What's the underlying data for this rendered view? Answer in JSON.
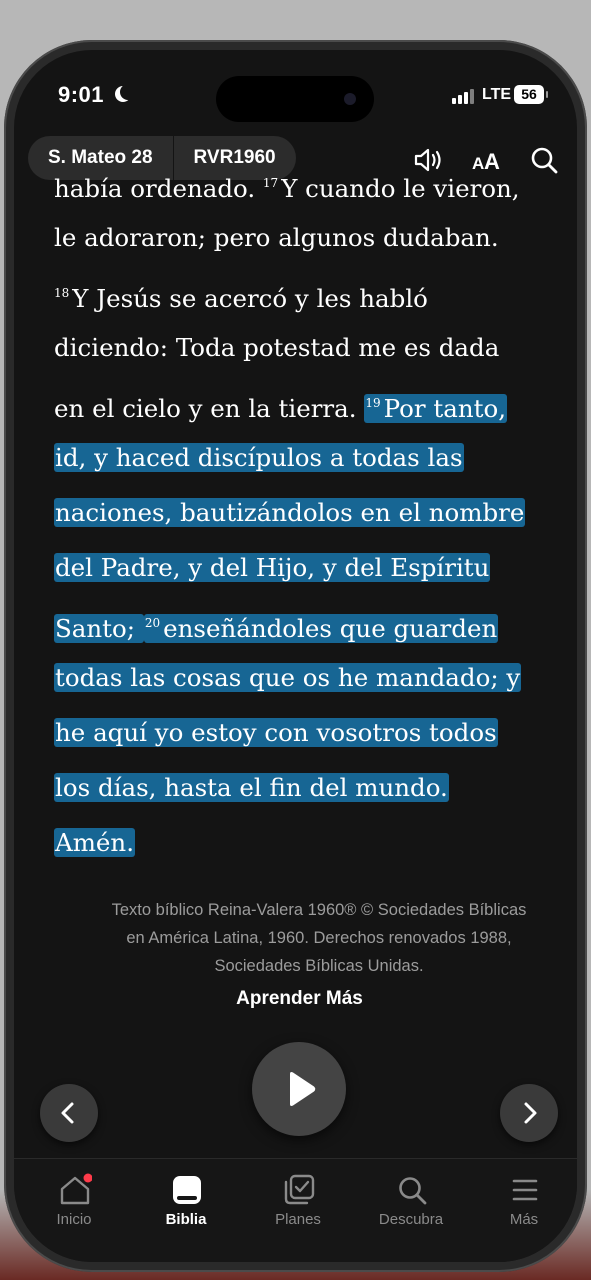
{
  "status_bar": {
    "time": "9:01",
    "network": "LTE",
    "battery": "56"
  },
  "toolbar": {
    "book_chapter": "S. Mateo 28",
    "version": "RVR1960"
  },
  "reader": {
    "lines": [
      {
        "segments": [
          {
            "text": "había ordenado. ",
            "hl": false
          },
          {
            "sup": "17",
            "text": "Y cuando le vieron,",
            "hl": false
          }
        ]
      },
      {
        "segments": [
          {
            "text": "le adoraron; pero algunos dudaban.",
            "hl": false
          }
        ]
      },
      {
        "segments": [
          {
            "sup": "18",
            "text": "Y Jesús se acercó y les habló",
            "hl": false
          }
        ]
      },
      {
        "segments": [
          {
            "text": "diciendo: Toda potestad me es dada",
            "hl": false
          }
        ]
      },
      {
        "segments": [
          {
            "text": "en el cielo y en la tierra. ",
            "hl": false
          },
          {
            "sup": "19",
            "text": "Por tanto,",
            "hl": true
          }
        ]
      },
      {
        "segments": [
          {
            "text": "id, y haced discípulos a todas las",
            "hl": true
          }
        ]
      },
      {
        "segments": [
          {
            "text": "naciones, bautizándolos en el nombre",
            "hl": true
          }
        ]
      },
      {
        "segments": [
          {
            "text": "del Padre, y del Hijo, y del Espíritu",
            "hl": true
          }
        ]
      },
      {
        "segments": [
          {
            "text": "Santo; ",
            "hl": true
          },
          {
            "sup": "20",
            "text": "enseñándoles que guarden",
            "hl": true
          }
        ]
      },
      {
        "segments": [
          {
            "text": "todas las cosas que os he mandado; y",
            "hl": true
          }
        ]
      },
      {
        "segments": [
          {
            "text": "he aquí yo estoy con vosotros todos",
            "hl": true
          }
        ]
      },
      {
        "segments": [
          {
            "text": "los días, hasta el fin del mundo.",
            "hl": true
          }
        ]
      },
      {
        "segments": [
          {
            "text": "Amén.",
            "hl": true
          }
        ]
      }
    ]
  },
  "copyright": {
    "line1": "Texto bíblico Reina-Valera 1960® © Sociedades Bíblicas",
    "line2": "en América Latina, 1960. Derechos renovados 1988,",
    "line3": "Sociedades Bíblicas Unidas."
  },
  "learn_more": "Aprender Más",
  "tabs": [
    {
      "label": "Inicio",
      "icon": "home-icon",
      "active": false,
      "badge": true
    },
    {
      "label": "Biblia",
      "icon": "bible-icon",
      "active": true
    },
    {
      "label": "Planes",
      "icon": "plans-icon",
      "active": false
    },
    {
      "label": "Descubra",
      "icon": "search-icon",
      "active": false
    },
    {
      "label": "Más",
      "icon": "menu-icon",
      "active": false
    }
  ],
  "colors": {
    "highlight": "#176694",
    "background": "#141414",
    "badge": "#ff3b4a"
  }
}
